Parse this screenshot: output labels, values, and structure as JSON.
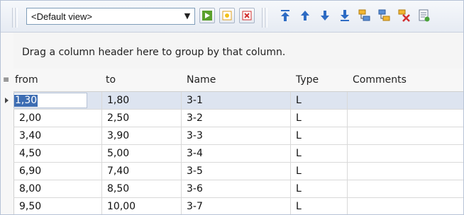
{
  "toolbar": {
    "view_select_value": "<Default view>",
    "icons": [
      "go-arrow-icon",
      "new-row-icon",
      "delete-x-icon",
      "move-top-icon",
      "move-up-icon",
      "move-down-icon",
      "move-bottom-icon",
      "group-icon",
      "ungroup-icon",
      "clear-grouping-icon",
      "export-report-icon"
    ]
  },
  "group_panel": {
    "hint": "Drag a column header here to group by that column."
  },
  "grid": {
    "columns": [
      "from",
      "to",
      "Name",
      "Type",
      "Comments"
    ],
    "rows": [
      {
        "from": "1,30",
        "to": "1,80",
        "name": "3-1",
        "type": "L",
        "comments": ""
      },
      {
        "from": "2,00",
        "to": "2,50",
        "name": "3-2",
        "type": "L",
        "comments": ""
      },
      {
        "from": "3,40",
        "to": "3,90",
        "name": "3-3",
        "type": "L",
        "comments": ""
      },
      {
        "from": "4,50",
        "to": "5,00",
        "name": "3-4",
        "type": "L",
        "comments": ""
      },
      {
        "from": "6,90",
        "to": "7,40",
        "name": "3-5",
        "type": "L",
        "comments": ""
      },
      {
        "from": "8,00",
        "to": "8,50",
        "name": "3-6",
        "type": "L",
        "comments": ""
      },
      {
        "from": "9,50",
        "to": "10,00",
        "name": "3-7",
        "type": "L",
        "comments": ""
      }
    ],
    "selected_row": 0,
    "colors": {
      "selected_row": "#dde4f0",
      "selection_text": "#3d6db3"
    }
  }
}
